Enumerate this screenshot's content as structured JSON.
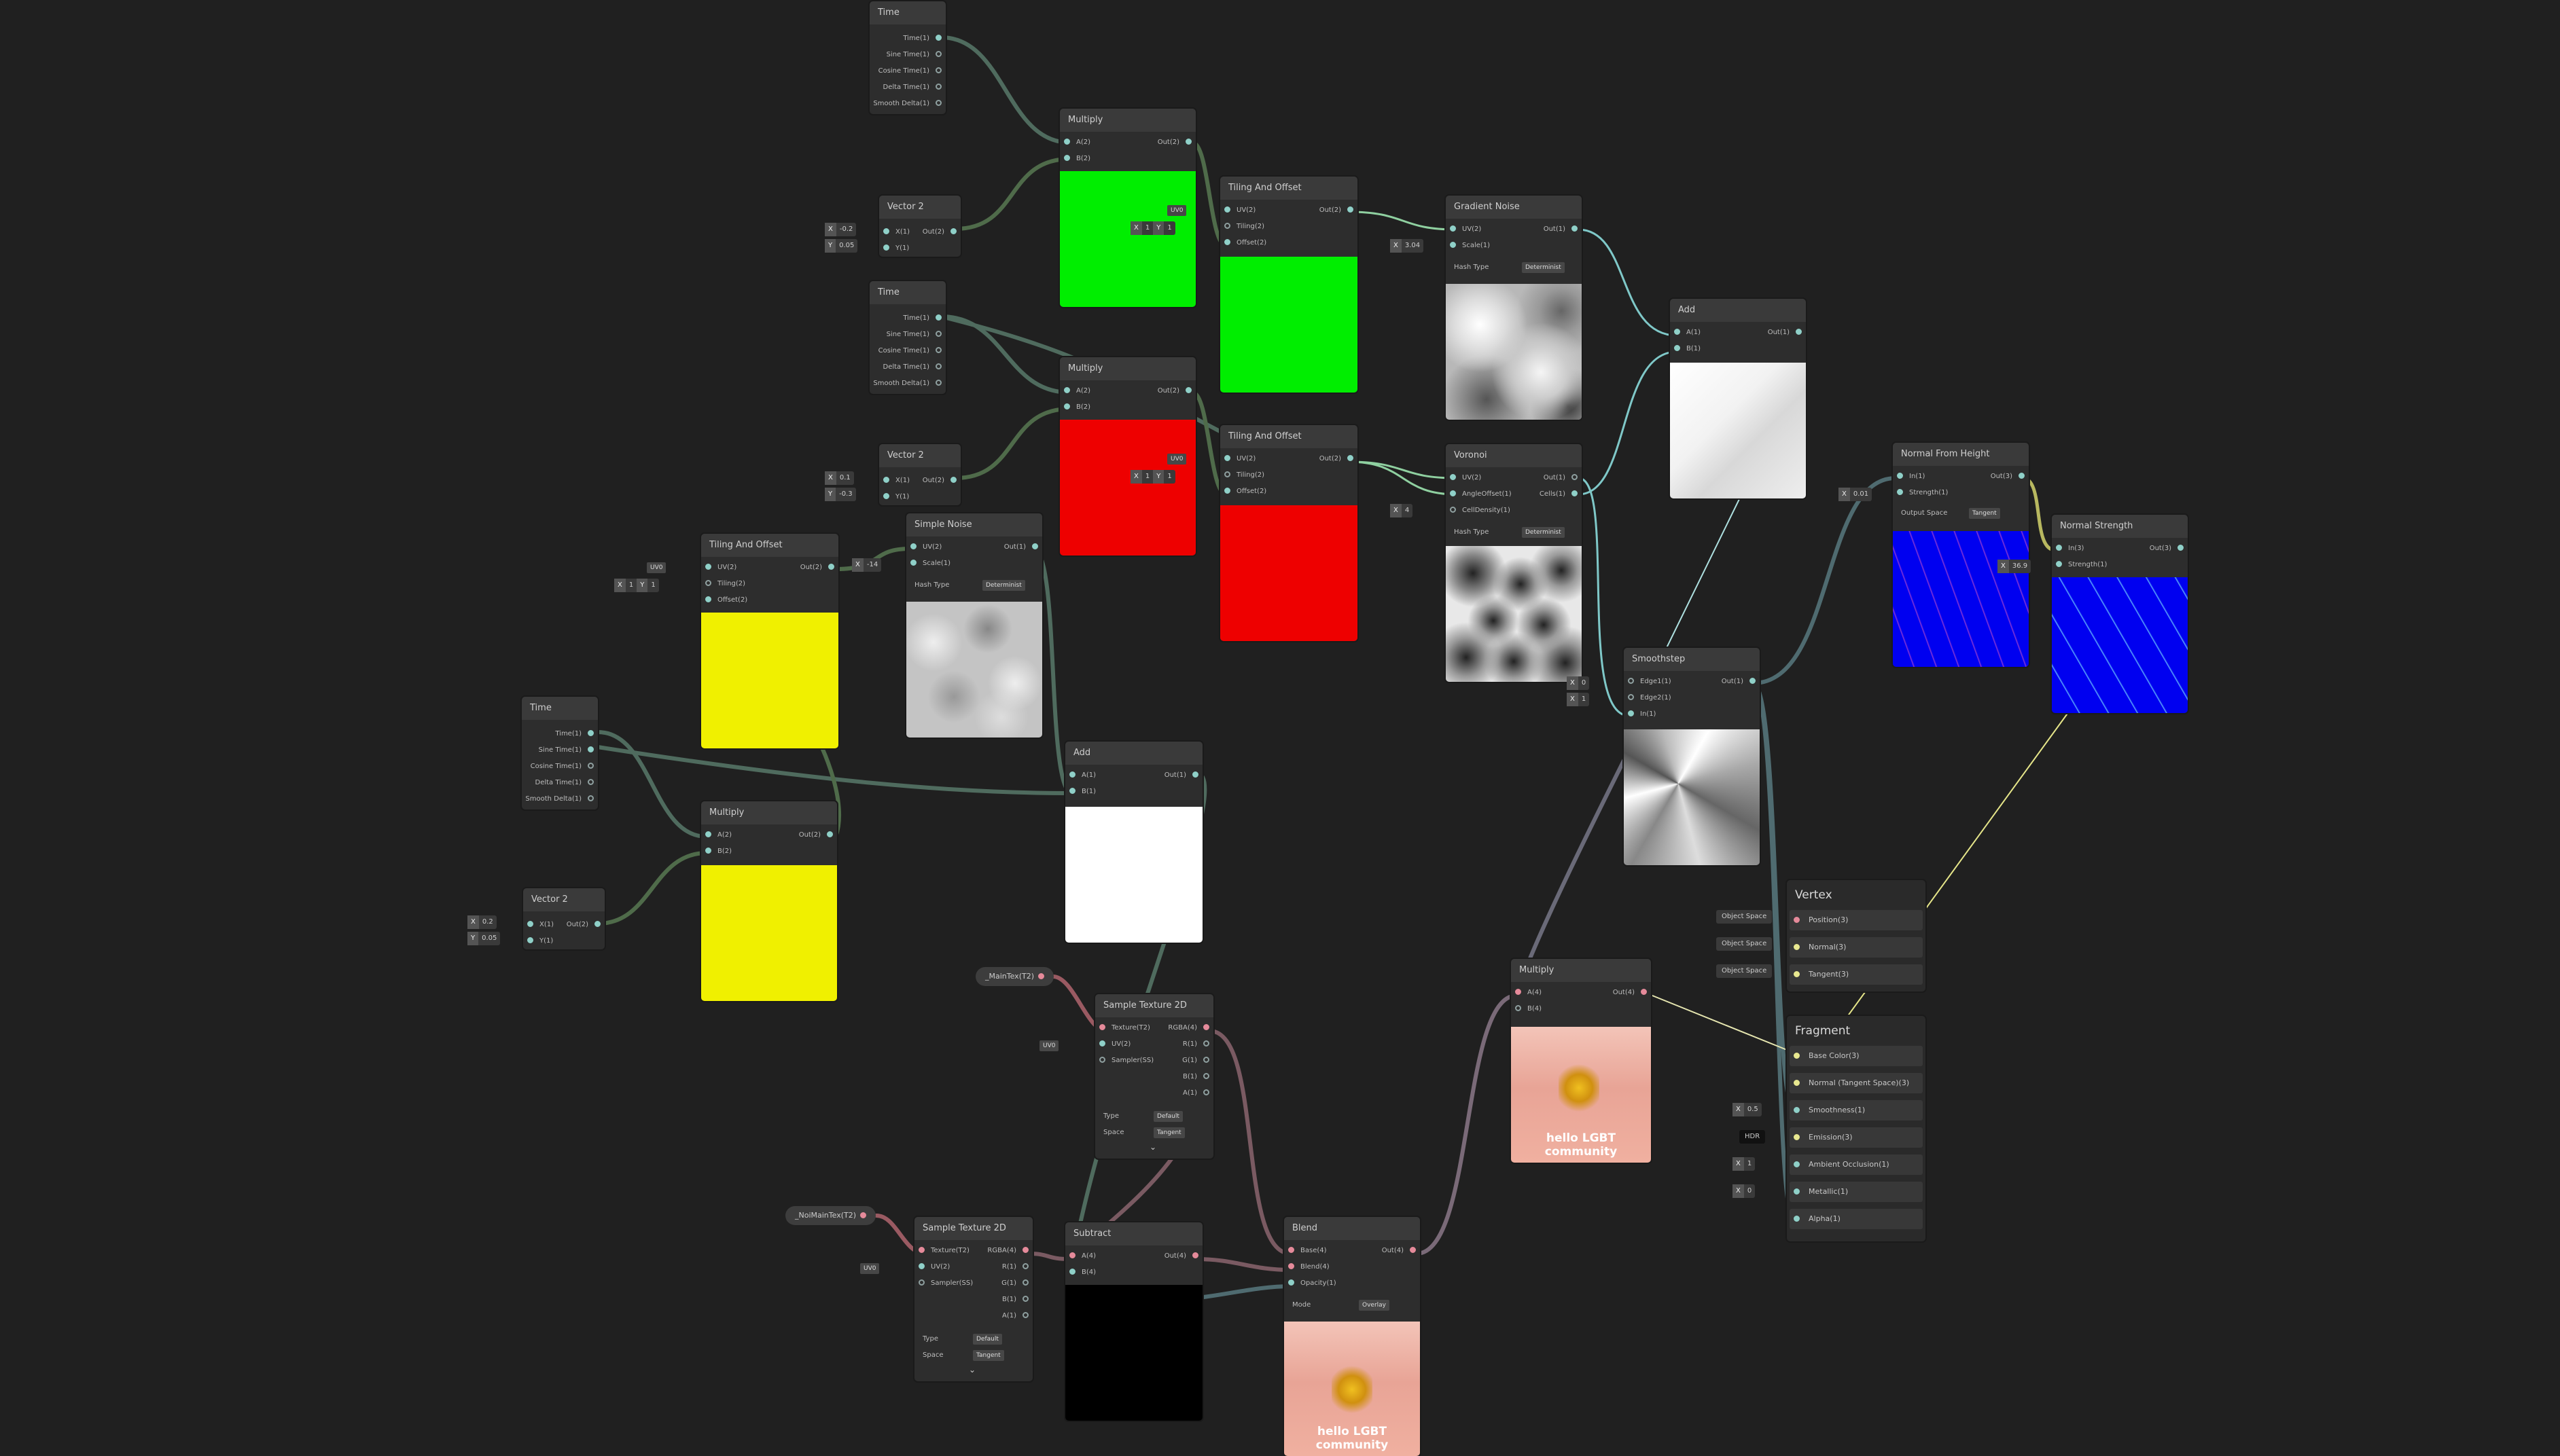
{
  "time_ports": [
    "Time(1)",
    "Sine Time(1)",
    "Cosine Time(1)",
    "Delta Time(1)",
    "Smooth Delta(1)"
  ],
  "nodes": {
    "time_a": {
      "title": "Time"
    },
    "time_b": {
      "title": "Time"
    },
    "time_c": {
      "title": "Time"
    },
    "vec2_a": {
      "title": "Vector 2",
      "in1": "X(1)",
      "in2": "Y(1)",
      "out": "Out(2)",
      "x": "-0.2",
      "y": "0.05"
    },
    "vec2_b": {
      "title": "Vector 2",
      "in1": "X(1)",
      "in2": "Y(1)",
      "out": "Out(2)",
      "x": "0.1",
      "y": "-0.3"
    },
    "vec2_c": {
      "title": "Vector 2",
      "in1": "X(1)",
      "in2": "Y(1)",
      "out": "Out(2)",
      "x": "0.2",
      "y": "0.05"
    },
    "mul_a": {
      "title": "Multiply",
      "in1": "A(2)",
      "in2": "B(2)",
      "out": "Out(2)"
    },
    "mul_b": {
      "title": "Multiply",
      "in1": "A(2)",
      "in2": "B(2)",
      "out": "Out(2)"
    },
    "mul_c": {
      "title": "Multiply",
      "in1": "A(2)",
      "in2": "B(2)",
      "out": "Out(2)"
    },
    "mul_d": {
      "title": "Multiply",
      "in1": "A(4)",
      "in2": "B(4)",
      "out": "Out(4)"
    },
    "tao_a": {
      "title": "Tiling And Offset",
      "in1": "UV(2)",
      "in2": "Tiling(2)",
      "in3": "Offset(2)",
      "out": "Out(2)",
      "uv": "UV0",
      "tx": "1",
      "ty": "1"
    },
    "tao_b": {
      "title": "Tiling And Offset",
      "in1": "UV(2)",
      "in2": "Tiling(2)",
      "in3": "Offset(2)",
      "out": "Out(2)",
      "uv": "UV0",
      "tx": "1",
      "ty": "1"
    },
    "tao_c": {
      "title": "Tiling And Offset",
      "in1": "UV(2)",
      "in2": "Tiling(2)",
      "in3": "Offset(2)",
      "out": "Out(2)",
      "uv": "UV0",
      "tx": "1",
      "ty": "1"
    },
    "gradnoise": {
      "title": "Gradient Noise",
      "in1": "UV(2)",
      "in2": "Scale(1)",
      "out": "Out(1)",
      "scale": "3.04",
      "hash_label": "Hash Type",
      "hash_val": "Determinist"
    },
    "voronoi": {
      "title": "Voronoi",
      "in1": "UV(2)",
      "in2": "AngleOffset(1)",
      "in3": "CellDensity(1)",
      "out1": "Out(1)",
      "out2": "Cells(1)",
      "density": "4",
      "hash_label": "Hash Type",
      "hash_val": "Determinist"
    },
    "simplenoise": {
      "title": "Simple Noise",
      "in1": "UV(2)",
      "in2": "Scale(1)",
      "out": "Out(1)",
      "scale": "-14",
      "hash_label": "Hash Type",
      "hash_val": "Determinist"
    },
    "add_a": {
      "title": "Add",
      "in1": "A(1)",
      "in2": "B(1)",
      "out": "Out(1)"
    },
    "add_b": {
      "title": "Add",
      "in1": "A(1)",
      "in2": "B(1)",
      "out": "Out(1)"
    },
    "smoothstep": {
      "title": "Smoothstep",
      "in1": "Edge1(1)",
      "in2": "Edge2(1)",
      "in3": "In(1)",
      "out": "Out(1)",
      "e1": "0",
      "e2": "1"
    },
    "nfh": {
      "title": "Normal From Height",
      "in1": "In(1)",
      "in2": "Strength(1)",
      "out": "Out(3)",
      "strength": "0.01",
      "space_label": "Output Space",
      "space_val": "Tangent"
    },
    "nstr": {
      "title": "Normal Strength",
      "in1": "In(3)",
      "in2": "Strength(1)",
      "out": "Out(3)",
      "strength": "36.9"
    },
    "st2d_a": {
      "title": "Sample Texture 2D",
      "in1": "Texture(T2)",
      "in2": "UV(2)",
      "in3": "Sampler(SS)",
      "outs": [
        "RGBA(4)",
        "R(1)",
        "G(1)",
        "B(1)",
        "A(1)"
      ],
      "uv": "UV0",
      "type_label": "Type",
      "type_val": "Default",
      "space_label": "Space",
      "space_val": "Tangent"
    },
    "st2d_b": {
      "title": "Sample Texture 2D",
      "in1": "Texture(T2)",
      "in2": "UV(2)",
      "in3": "Sampler(SS)",
      "outs": [
        "RGBA(4)",
        "R(1)",
        "G(1)",
        "B(1)",
        "A(1)"
      ],
      "uv": "UV0",
      "type_label": "Type",
      "type_val": "Default",
      "space_label": "Space",
      "space_val": "Tangent"
    },
    "subtract": {
      "title": "Subtract",
      "in1": "A(4)",
      "in2": "B(4)",
      "out": "Out(4)"
    },
    "blend": {
      "title": "Blend",
      "in1": "Base(4)",
      "in2": "Blend(4)",
      "in3": "Opacity(1)",
      "out": "Out(4)",
      "mode_label": "Mode",
      "mode_val": "Overlay"
    }
  },
  "props": {
    "maintex": "_MainTex(T2)",
    "noimain": "_NoiMainTex(T2)"
  },
  "preview_text": "hello LGBT community",
  "vertex": {
    "title": "Vertex",
    "slots": [
      "Position(3)",
      "Normal(3)",
      "Tangent(3)"
    ],
    "space": "Object Space"
  },
  "fragment": {
    "title": "Fragment",
    "slots": [
      "Base Color(3)",
      "Normal (Tangent Space)(3)",
      "Smoothness(1)",
      "Emission(3)",
      "Ambient Occlusion(1)",
      "Metallic(1)",
      "Alpha(1)"
    ],
    "smoothness": "0.5",
    "emission": "HDR",
    "ao": "1",
    "metallic": "0"
  },
  "axis": {
    "x": "X",
    "y": "Y"
  }
}
